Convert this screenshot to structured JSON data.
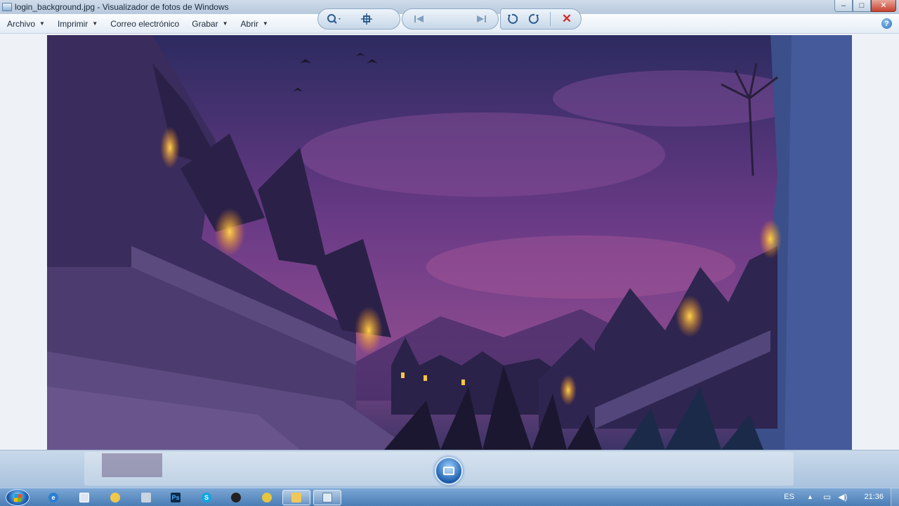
{
  "window": {
    "title": "login_background.jpg - Visualizador de fotos de Windows",
    "controls": {
      "minimize": "–",
      "maximize": "□",
      "close": "✕"
    }
  },
  "menubar": {
    "items": [
      {
        "label": "Archivo",
        "has_dropdown": true
      },
      {
        "label": "Imprimir",
        "has_dropdown": true
      },
      {
        "label": "Correo electrónico",
        "has_dropdown": false
      },
      {
        "label": "Grabar",
        "has_dropdown": true
      },
      {
        "label": "Abrir",
        "has_dropdown": true
      }
    ],
    "help_label": "?"
  },
  "toolbar": {
    "zoom_icon": "magnifier-icon",
    "fit_icon": "actual-size-icon",
    "prev_icon": "previous-icon",
    "slideshow_icon": "slideshow-icon",
    "next_icon": "next-icon",
    "rotate_left_icon": "rotate-left-icon",
    "rotate_right_icon": "rotate-right-icon",
    "delete_icon": "delete-icon"
  },
  "taskbar": {
    "apps": [
      "ie",
      "explorer-window",
      "paint",
      "media",
      "photoshop",
      "skype",
      "obs",
      "lock",
      "folder",
      "photo-viewer"
    ],
    "language": "ES",
    "clock": "21:36"
  },
  "colors": {
    "titlebar": "#b7c9dc",
    "taskbar": "#4a7db5",
    "close_button": "#c8412e",
    "delete_red": "#d22a2a"
  }
}
